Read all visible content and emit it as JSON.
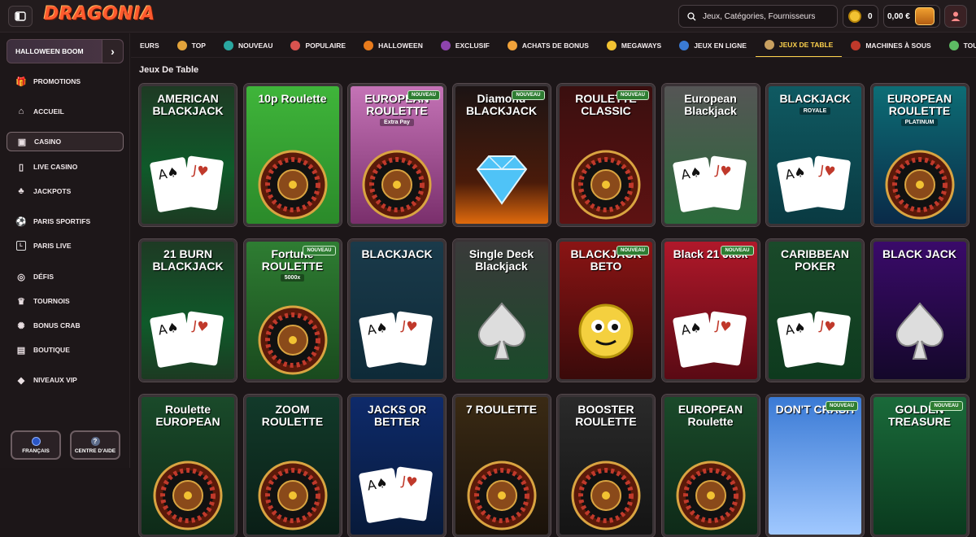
{
  "header": {
    "logo": "DRAGONIA",
    "search_placeholder": "Jeux, Catégories, Fournisseurs",
    "coins": "0",
    "balance": "0,00 €"
  },
  "sidebar": {
    "promo": "HALLOWEEN BOOM",
    "items": [
      {
        "label": "PROMOTIONS",
        "icon": "gift-icon"
      },
      {
        "label": "ACCUEIL",
        "icon": "home-icon"
      },
      {
        "label": "CASINO",
        "icon": "slot-icon"
      },
      {
        "label": "LIVE CASINO",
        "icon": "phone-icon"
      },
      {
        "label": "JACKPOTS",
        "icon": "clover-icon"
      },
      {
        "label": "PARIS SPORTIFS",
        "icon": "ball-icon"
      },
      {
        "label": "PARIS LIVE",
        "icon": "live-icon"
      },
      {
        "label": "DÉFIS",
        "icon": "medal-icon"
      },
      {
        "label": "TOURNOIS",
        "icon": "trophy-icon"
      },
      {
        "label": "BONUS CRAB",
        "icon": "crab-icon"
      },
      {
        "label": "BOUTIQUE",
        "icon": "bag-icon"
      },
      {
        "label": "NIVEAUX VIP",
        "icon": "diamond-icon"
      }
    ],
    "language": "FRANÇAIS",
    "help": "CENTRE D'AIDE"
  },
  "categories": [
    {
      "label": "EURS",
      "color": "#888"
    },
    {
      "label": "TOP",
      "color": "#e2a33b"
    },
    {
      "label": "NOUVEAU",
      "color": "#2aa7a0"
    },
    {
      "label": "POPULAIRE",
      "color": "#d9534f"
    },
    {
      "label": "HALLOWEEN",
      "color": "#e87b1c"
    },
    {
      "label": "EXCLUSIF",
      "color": "#8e44ad"
    },
    {
      "label": "ACHATS DE BONUS",
      "color": "#f1a23a"
    },
    {
      "label": "MEGAWAYS",
      "color": "#f1c232"
    },
    {
      "label": "JEUX EN LIGNE",
      "color": "#3a7bd5"
    },
    {
      "label": "JEUX DE TABLE",
      "color": "#c8a060"
    },
    {
      "label": "MACHINES À SOUS",
      "color": "#c0392b"
    },
    {
      "label": "TOUS LES JEUX",
      "color": "#5dbb63"
    }
  ],
  "section_title": "Jeux De Table",
  "badge_label": "NOUVEAU",
  "games": [
    {
      "title": "AMERICAN BLACKJACK",
      "sub": "",
      "badge": false,
      "bg": "linear-gradient(#1e3a24,#0f5a2a 60%,#1c3a22)",
      "art": "cards"
    },
    {
      "title": "10p Roulette",
      "sub": "",
      "badge": false,
      "bg": "linear-gradient(#3fb53a,#2b8a2a)",
      "art": "wheel"
    },
    {
      "title": "EUROPEAN ROULETTE",
      "sub": "Extra Pay",
      "badge": true,
      "bg": "linear-gradient(#c473b6,#7a2f6c)",
      "art": "wheel"
    },
    {
      "title": "Diamond BLACKJACK",
      "sub": "",
      "badge": true,
      "bg": "linear-gradient(#1c1414,#4a1b0a 70%,#e06a0c)",
      "art": "diamond"
    },
    {
      "title": "ROULETTE CLASSIC",
      "sub": "",
      "badge": true,
      "bg": "linear-gradient(#3a0f0f,#5e1212)",
      "art": "wheel"
    },
    {
      "title": "European Blackjack",
      "sub": "",
      "badge": false,
      "bg": "linear-gradient(#555,#2a6a3a)",
      "art": "cards"
    },
    {
      "title": "BLACKJACK",
      "sub": "ROYALE",
      "badge": false,
      "bg": "linear-gradient(#0f5a62,#0a3a42)",
      "art": "cards"
    },
    {
      "title": "EUROPEAN ROULETTE",
      "sub": "PLATINUM",
      "badge": false,
      "bg": "linear-gradient(#0d6d75,#0a2a48)",
      "art": "wheel"
    },
    {
      "title": "21 BURN BLACKJACK",
      "sub": "",
      "badge": false,
      "bg": "linear-gradient(#1e3a24,#0f5a2a 60%,#1c3a22)",
      "art": "cards"
    },
    {
      "title": "Fortune ROULETTE",
      "sub": "5000x",
      "badge": true,
      "bg": "linear-gradient(#2e7d32,#1a4a1e)",
      "art": "wheel"
    },
    {
      "title": "BLACKJACK",
      "sub": "",
      "badge": false,
      "bg": "linear-gradient(#1a3a4a,#0e2a38)",
      "art": "cards"
    },
    {
      "title": "Single Deck Blackjack",
      "sub": "",
      "badge": false,
      "bg": "linear-gradient(#3a3a3a,#1a4a2a)",
      "art": "spade"
    },
    {
      "title": "BLACKJACK BETO",
      "sub": "",
      "badge": true,
      "bg": "linear-gradient(#8a1414,#3a0a0a)",
      "art": "face"
    },
    {
      "title": "Black 21 Jack",
      "sub": "",
      "badge": true,
      "bg": "linear-gradient(#b0182a,#5a0a14)",
      "art": "cards"
    },
    {
      "title": "CARIBBEAN POKER",
      "sub": "",
      "badge": false,
      "bg": "linear-gradient(#1a4a2a,#0e3a1e)",
      "art": "cards"
    },
    {
      "title": "BLACK JACK",
      "sub": "",
      "badge": false,
      "bg": "linear-gradient(#3a0a6a,#14082a)",
      "art": "spade"
    },
    {
      "title": "Roulette EUROPEAN",
      "sub": "",
      "badge": false,
      "bg": "linear-gradient(#1a4a2a,#0e2a18)",
      "art": "wheel"
    },
    {
      "title": "ZOOM ROULETTE",
      "sub": "",
      "badge": false,
      "bg": "linear-gradient(#123a2a,#0a1e16)",
      "art": "wheel"
    },
    {
      "title": "JACKS OR BETTER",
      "sub": "",
      "badge": false,
      "bg": "linear-gradient(#0e2a6a,#081a3a)",
      "art": "cards"
    },
    {
      "title": "7 ROULETTE",
      "sub": "",
      "badge": false,
      "bg": "linear-gradient(#3a2a14,#1a120a)",
      "art": "wheel"
    },
    {
      "title": "BOOSTER ROULETTE",
      "sub": "",
      "badge": false,
      "bg": "linear-gradient(#2a2a2a,#141414)",
      "art": "wheel"
    },
    {
      "title": "EUROPEAN Roulette",
      "sub": "",
      "badge": false,
      "bg": "linear-gradient(#1a4a2a,#0e2a18)",
      "art": "wheel"
    },
    {
      "title": "DON'T CRASH",
      "sub": "",
      "badge": true,
      "bg": "linear-gradient(#3a7ad5,#a0c8ff)",
      "art": "none"
    },
    {
      "title": "GOLDEN TREASURE",
      "sub": "",
      "badge": true,
      "bg": "linear-gradient(#1a6a3a,#0a3a1e)",
      "art": "none"
    }
  ]
}
